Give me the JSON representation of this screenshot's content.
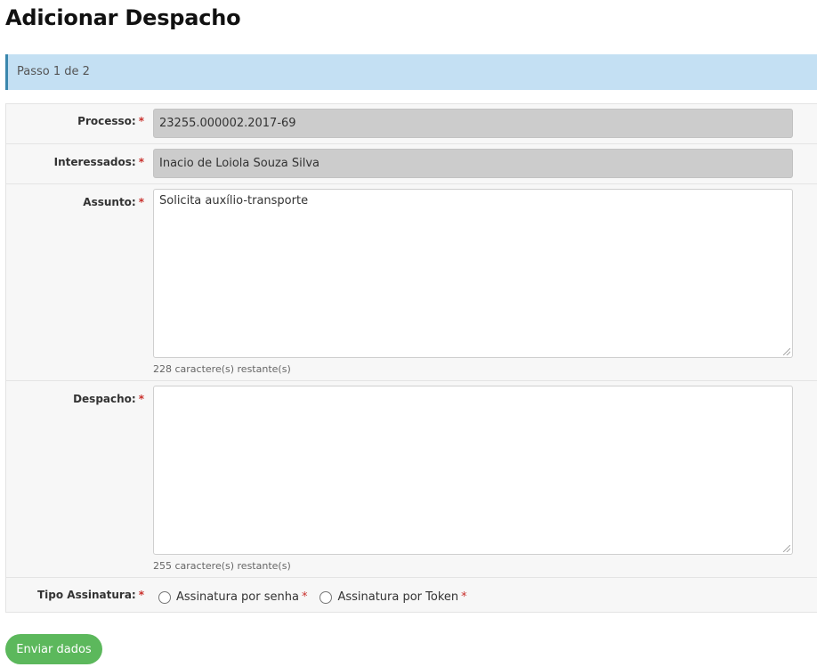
{
  "page": {
    "title": "Adicionar Despacho"
  },
  "step": {
    "text": "Passo 1 de 2"
  },
  "form": {
    "required_mark": "*",
    "processo": {
      "label": "Processo:",
      "value": "23255.000002.2017-69"
    },
    "interessados": {
      "label": "Interessados:",
      "value": "Inacio de Loiola Souza Silva"
    },
    "assunto": {
      "label": "Assunto:",
      "value": "Solicita auxílio-transporte",
      "counter": "228 caractere(s) restante(s)"
    },
    "despacho": {
      "label": "Despacho:",
      "value": "",
      "counter": "255 caractere(s) restante(s)"
    },
    "tipo_assinatura": {
      "label": "Tipo Assinatura:",
      "options": [
        {
          "label": "Assinatura por senha",
          "selected": false
        },
        {
          "label": "Assinatura por Token",
          "selected": false
        }
      ]
    }
  },
  "actions": {
    "submit_label": "Enviar dados"
  },
  "colors": {
    "accent_blue": "#c4e0f3",
    "required_red": "#c9302c",
    "submit_green": "#5cb85c"
  }
}
